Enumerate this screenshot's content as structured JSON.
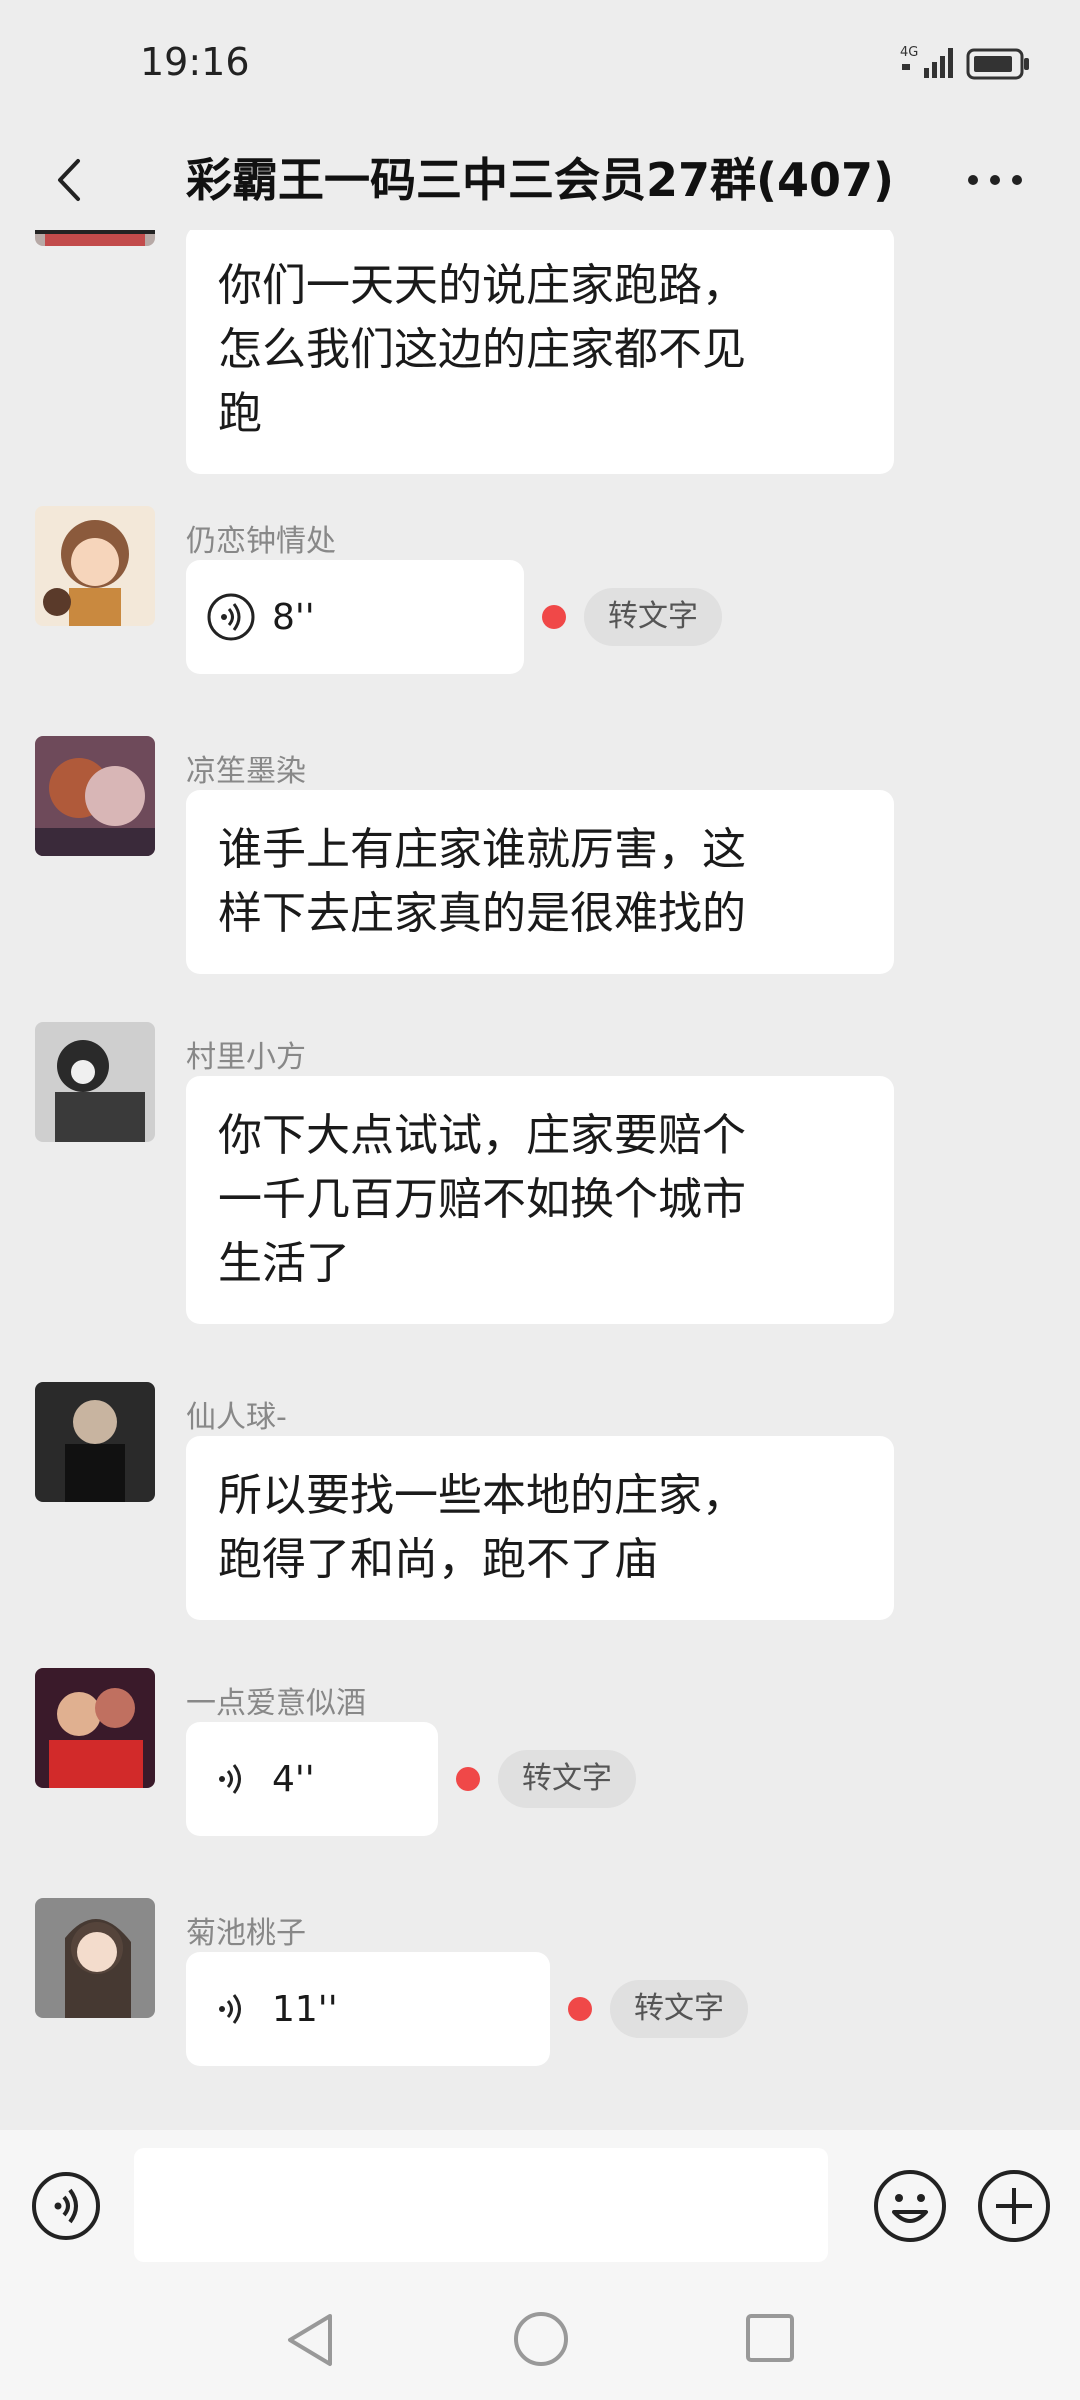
{
  "status_bar": {
    "time": "19:16",
    "network": "4G"
  },
  "header": {
    "title": "彩霸王一码三中三会员27群(407)"
  },
  "messages": [
    {
      "type": "text",
      "sender": "",
      "lines": [
        "你们一天天的说庄家跑路，",
        "怎么我们这边的庄家都不见",
        "跑"
      ]
    },
    {
      "type": "voice",
      "sender": "仍恋钟情处",
      "duration": "8''",
      "convert_label": "转文字"
    },
    {
      "type": "text",
      "sender": "凉笙墨染",
      "lines": [
        "谁手上有庄家谁就厉害，这",
        "样下去庄家真的是很难找的"
      ]
    },
    {
      "type": "text",
      "sender": "村里小方",
      "lines": [
        "你下大点试试，庄家要赔个",
        "一千几百万赔不如换个城市",
        "生活了"
      ]
    },
    {
      "type": "text",
      "sender": "仙人球-",
      "lines": [
        "所以要找一些本地的庄家，",
        "跑得了和尚，跑不了庙"
      ]
    },
    {
      "type": "voice",
      "sender": "一点爱意似酒",
      "duration": "4''",
      "convert_label": "转文字"
    },
    {
      "type": "voice",
      "sender": "菊池桃子",
      "duration": "11''",
      "convert_label": "转文字"
    }
  ],
  "input": {
    "placeholder": ""
  },
  "icons": {
    "back": "back-arrow-icon",
    "more": "more-dots-icon",
    "voice": "voice-wave-icon",
    "emoji": "emoji-smile-icon",
    "plus": "plus-icon"
  },
  "colors": {
    "background": "#ededed",
    "bubble": "#ffffff",
    "unread_dot": "#f04848",
    "name": "#888888"
  }
}
